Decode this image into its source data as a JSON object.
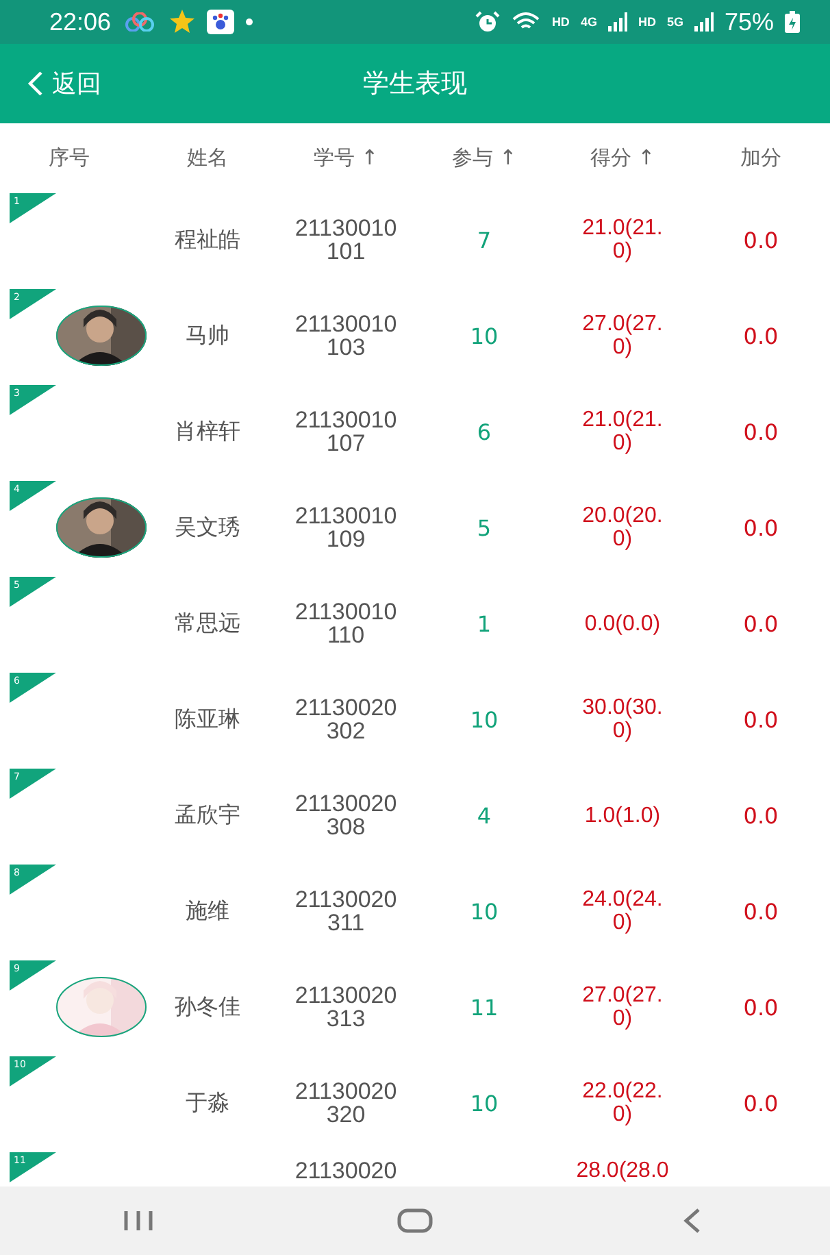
{
  "status_bar": {
    "time": "22:06",
    "network_labels": [
      "HD",
      "4G",
      "HD",
      "5G"
    ],
    "battery": "75%"
  },
  "header": {
    "back": "返回",
    "title": "学生表现"
  },
  "columns": [
    {
      "label": "序号"
    },
    {
      "label": "姓名"
    },
    {
      "label": "学号 ↑"
    },
    {
      "label": "参与 ↑"
    },
    {
      "label": "得分 ↑"
    },
    {
      "label": "加分"
    }
  ],
  "rows": [
    {
      "index": "1",
      "name": "程祉皓",
      "student_id": "21130010101",
      "participation": "7",
      "score": "21.0(21.0)",
      "bonus": "0.0"
    },
    {
      "index": "2",
      "name": "马帅",
      "student_id": "21130010103",
      "participation": "10",
      "score": "27.0(27.0)",
      "bonus": "0.0"
    },
    {
      "index": "3",
      "name": "肖梓轩",
      "student_id": "21130010107",
      "participation": "6",
      "score": "21.0(21.0)",
      "bonus": "0.0"
    },
    {
      "index": "4",
      "name": "吴文琇",
      "student_id": "21130010109",
      "participation": "5",
      "score": "20.0(20.0)",
      "bonus": "0.0"
    },
    {
      "index": "5",
      "name": "常思远",
      "student_id": "21130010110",
      "participation": "1",
      "score": "0.0(0.0)",
      "bonus": "0.0"
    },
    {
      "index": "6",
      "name": "陈亚琳",
      "student_id": "21130020302",
      "participation": "10",
      "score": "30.0(30.0)",
      "bonus": "0.0"
    },
    {
      "index": "7",
      "name": "孟欣宇",
      "student_id": "21130020308",
      "participation": "4",
      "score": "1.0(1.0)",
      "bonus": "0.0"
    },
    {
      "index": "8",
      "name": "施维",
      "student_id": "21130020311",
      "participation": "10",
      "score": "24.0(24.0)",
      "bonus": "0.0"
    },
    {
      "index": "9",
      "name": "孙冬佳",
      "student_id": "21130020313",
      "participation": "11",
      "score": "27.0(27.0)",
      "bonus": "0.0"
    },
    {
      "index": "10",
      "name": "于淼",
      "student_id": "21130020320",
      "participation": "10",
      "score": "22.0(22.0)",
      "bonus": "0.0"
    },
    {
      "index": "11",
      "kind": "partial",
      "student_id": "21130020",
      "score": "28.0(28.0"
    }
  ]
}
